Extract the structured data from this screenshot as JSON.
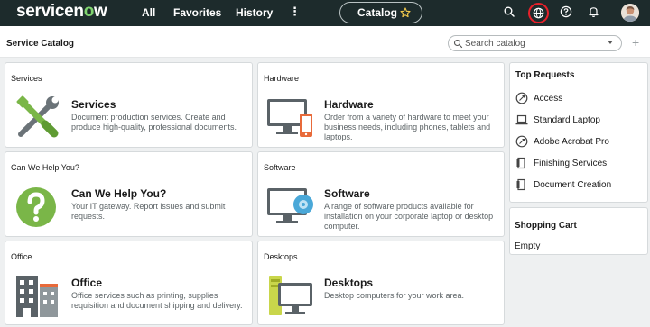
{
  "header": {
    "logo": "servicenow",
    "nav": {
      "all": "All",
      "favorites": "Favorites",
      "history": "History"
    },
    "more": "⋮",
    "pill_label": "Catalog"
  },
  "subheader": {
    "title": "Service Catalog",
    "search_placeholder": "Search catalog",
    "add": "+"
  },
  "cards": [
    {
      "category": "Services",
      "title": "Services",
      "description": "Document production services. Create and produce high-quality, professional documents.",
      "icon": "tools-icon"
    },
    {
      "category": "Hardware",
      "title": "Hardware",
      "description": "Order from a variety of hardware to meet your business needs, including phones, tablets and laptops.",
      "icon": "monitor-phone-icon"
    },
    {
      "category": "Can We Help You?",
      "title": "Can We Help You?",
      "description": "Your IT gateway. Report issues and submit requests.",
      "icon": "question-icon"
    },
    {
      "category": "Software",
      "title": "Software",
      "description": "A range of software products available for installation on your corporate laptop or desktop computer.",
      "icon": "monitor-disc-icon"
    },
    {
      "category": "Office",
      "title": "Office",
      "description": "Office services such as printing, supplies requisition and document shipping and delivery.",
      "icon": "building-icon"
    },
    {
      "category": "Desktops",
      "title": "Desktops",
      "description": "Desktop computers for your work area.",
      "icon": "desktops-icon"
    }
  ],
  "top_requests": {
    "title": "Top Requests",
    "items": [
      {
        "label": "Access",
        "icon": "access-icon"
      },
      {
        "label": "Standard Laptop",
        "icon": "laptop-icon"
      },
      {
        "label": "Adobe Acrobat Pro",
        "icon": "acrobat-icon"
      },
      {
        "label": "Finishing Services",
        "icon": "document-icon"
      },
      {
        "label": "Document Creation",
        "icon": "document-icon"
      }
    ]
  },
  "shopping_cart": {
    "title": "Shopping Cart",
    "empty": "Empty"
  },
  "colors": {
    "nav_bg": "#1d2b2c",
    "accent_green": "#7fd36f",
    "alert_red": "#e8202a",
    "icon_green": "#7ab648",
    "icon_blue": "#4aa8d8",
    "icon_orange": "#e86a3a"
  }
}
